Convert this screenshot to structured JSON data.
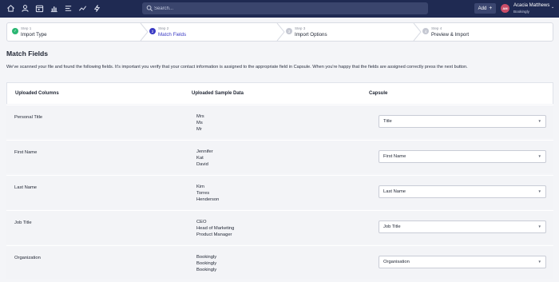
{
  "nav": {
    "icons": [
      "home-icon",
      "person-icon",
      "calendar-icon",
      "bar-chart-icon",
      "list-icon",
      "trend-line-icon",
      "lightning-icon"
    ]
  },
  "search": {
    "placeholder": "Search..."
  },
  "header": {
    "add_label": "Add",
    "user_initials": "AM",
    "user_name": "Acacia Matthews",
    "user_org": "Bookingly"
  },
  "stepper": {
    "steps": [
      {
        "num": "Step 1",
        "title": "Import Type",
        "state": "done"
      },
      {
        "num": "Step 2",
        "title": "Match Fields",
        "state": "active"
      },
      {
        "num": "Step 3",
        "title": "Import Options",
        "state": "pending"
      },
      {
        "num": "Step 4",
        "title": "Preview & Import",
        "state": "pending"
      }
    ],
    "circles": [
      "✓",
      "2",
      "3",
      "4"
    ]
  },
  "page": {
    "title": "Match Fields",
    "intro": "We've scanned your file and found the following fields. It's important you verify that your contact information is assigned to the appropriate field in Capsule. When you're happy that the fields are assigned correctly press the next button."
  },
  "table": {
    "headers": [
      "Uploaded Columns",
      "Uploaded Sample Data",
      "Capsule"
    ],
    "rows": [
      {
        "column": "Personal Title",
        "samples": [
          "Mrs",
          "Ms",
          "Mr"
        ],
        "capsule": "Title"
      },
      {
        "column": "First Name",
        "samples": [
          "Jennifer",
          "Kat",
          "David"
        ],
        "capsule": "First Name"
      },
      {
        "column": "Last Name",
        "samples": [
          "Kim",
          "Torres",
          "Henderson"
        ],
        "capsule": "Last Name"
      },
      {
        "column": "Job Title",
        "samples": [
          "CEO",
          "Head of Marketing",
          "Product Manager"
        ],
        "capsule": "Job Title"
      },
      {
        "column": "Organization",
        "samples": [
          "Bookingly",
          "Bookingly",
          "Bookingly"
        ],
        "capsule": "Organisation"
      }
    ]
  },
  "colors": {
    "topbar": "#1f2a52",
    "accent": "#3b3bc4",
    "done": "#2bb673",
    "pending": "#c5c8d2"
  }
}
